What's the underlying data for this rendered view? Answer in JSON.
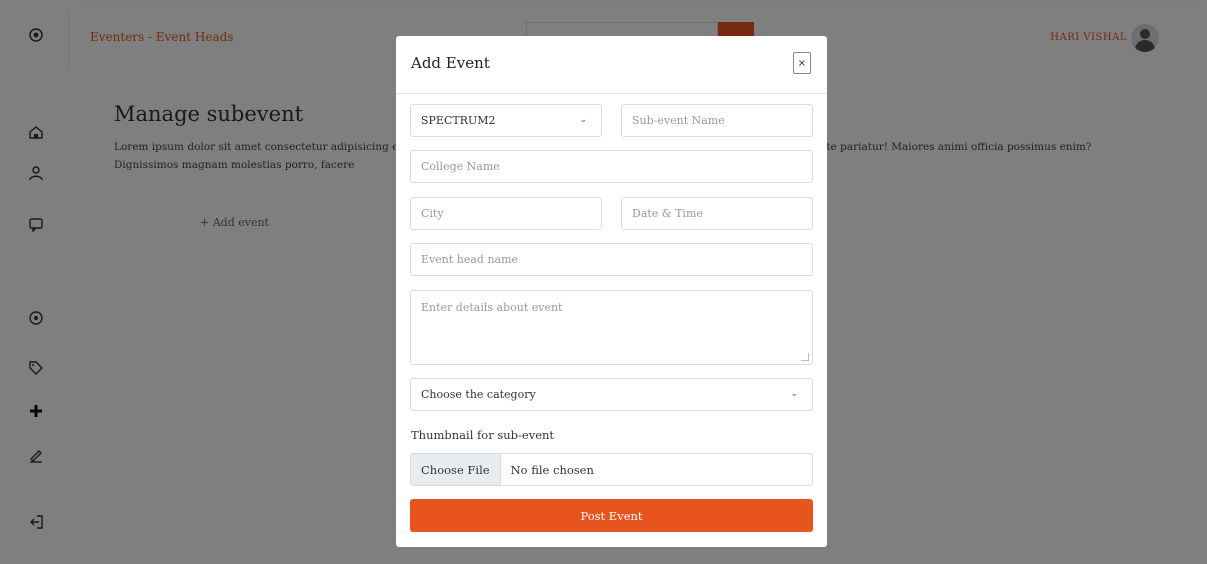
{
  "header": {
    "breadcrumb": "Eventers - Event Heads",
    "user_name": "HARI VISHAL"
  },
  "main": {
    "title": "Manage subevent",
    "description": "Lorem ipsum dolor sit amet consectetur adipisicing elit. Quidem, hic! Lorem ipsum dolor sit amet consectetur adipisicing elit. Sapiente pariatur! Maiores animi officia possimus enim? Dignissimos magnam molestias porro, facere",
    "add_event_link": "+ Add event"
  },
  "modal": {
    "title": "Add Event",
    "close_label": "×",
    "event_select": "SPECTRUM2",
    "subevent_name_placeholder": "Sub-event Name",
    "college_name_placeholder": "College Name",
    "city_placeholder": "City",
    "datetime_placeholder": "Date & Time",
    "event_head_placeholder": "Event head name",
    "details_placeholder": "Enter details about event",
    "category_select": "Choose the category",
    "thumbnail_label": "Thumbnail for sub-event",
    "choose_file_label": "Choose File",
    "file_status": "No file chosen",
    "post_button": "Post Event"
  },
  "sidebar": {
    "icons": [
      "logo-icon",
      "home-icon",
      "user-icon",
      "message-icon",
      "target-icon",
      "tag-icon",
      "plus-icon",
      "edit-icon",
      "logout-icon"
    ]
  },
  "colors": {
    "accent": "#e8541e",
    "overlay": "rgba(0,0,0,0.5)"
  }
}
